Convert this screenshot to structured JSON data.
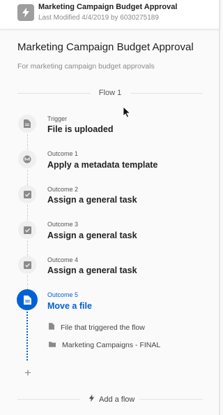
{
  "header": {
    "icon": "lightning-icon",
    "title": "Marketing Campaign Budget Approval",
    "subtitle": "Last Modified 4/4/2019 by 6030275189"
  },
  "page": {
    "title": "Marketing Campaign Budget Approval",
    "description": "For marketing campaign budget approvals"
  },
  "flow": {
    "label": "Flow 1",
    "steps": [
      {
        "kicker": "Trigger",
        "name": "File is uploaded",
        "icon": "file-icon",
        "active": false
      },
      {
        "kicker": "Outcome 1",
        "name": "Apply a metadata template",
        "icon": "metadata-icon",
        "active": false
      },
      {
        "kicker": "Outcome 2",
        "name": "Assign a general task",
        "icon": "checkbox-icon",
        "active": false
      },
      {
        "kicker": "Outcome 3",
        "name": "Assign a general task",
        "icon": "checkbox-icon",
        "active": false
      },
      {
        "kicker": "Outcome 4",
        "name": "Assign a general task",
        "icon": "checkbox-icon",
        "active": false
      },
      {
        "kicker": "Outcome 5",
        "name": "Move a file",
        "icon": "file-icon",
        "active": true
      }
    ],
    "details": [
      {
        "icon": "file-icon",
        "text": "File that triggered the flow"
      },
      {
        "icon": "folder-icon",
        "text": "Marketing Campaigns - FINAL"
      }
    ],
    "add_step_symbol": "+"
  },
  "add_flow": {
    "label": "Add a flow",
    "icon": "lightning-icon"
  },
  "colors": {
    "accent": "#0061d5",
    "muted": "#8a8a8a",
    "icon_bg": "#efefef"
  }
}
